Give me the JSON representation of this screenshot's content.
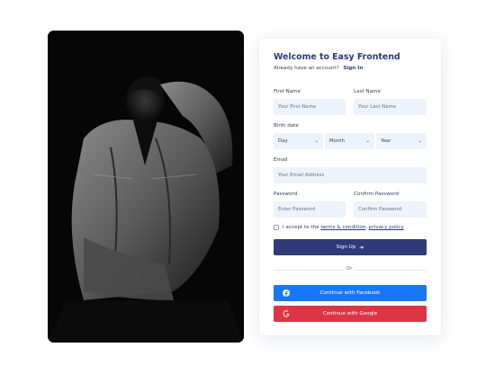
{
  "form": {
    "title": "Welcome to Easy Frontend",
    "have_account": "Already have an account?",
    "sign_in": "Sign In",
    "first_name": {
      "label": "First Name",
      "placeholder": "Your First Name"
    },
    "last_name": {
      "label": "Last Name",
      "placeholder": "Your Last Name"
    },
    "birth_date": {
      "label": "Birth date",
      "day": "Day",
      "month": "Month",
      "year": "Year"
    },
    "email": {
      "label": "Email",
      "placeholder": "Your Email Address"
    },
    "password": {
      "label": "Password",
      "placeholder": "Enter Password"
    },
    "confirm_password": {
      "label": "Confirm Password",
      "placeholder": "Confirm Password"
    },
    "terms": {
      "prefix": "I accept to the",
      "link1": "terms & condition",
      "sep": ",",
      "link2": "privacy policy"
    },
    "signup_label": "Sign Up",
    "or": "Or",
    "facebook_label": "Continue with Facebook",
    "google_label": "Continue with Google"
  },
  "icons": {
    "chevron": "chevron-down-icon",
    "arrow": "arrow-right-icon",
    "facebook": "facebook-icon",
    "google": "google-icon"
  },
  "colors": {
    "primary": "#2e3b78",
    "facebook": "#1877f2",
    "google": "#dc3545",
    "input_bg": "#eef2fb"
  }
}
